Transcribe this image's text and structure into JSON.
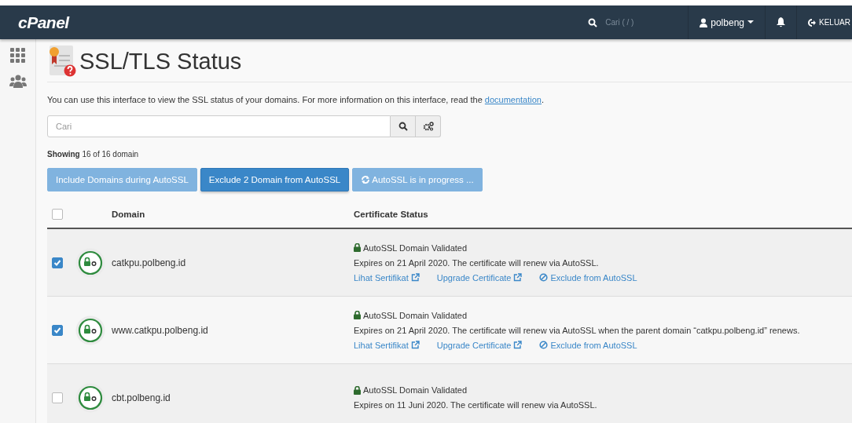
{
  "topbar": {
    "logo": "cPanel",
    "search": {
      "placeholder": "Cari ( / )"
    },
    "user": "polbeng",
    "logout": "KELUAR"
  },
  "page": {
    "title": "SSL/TLS Status",
    "intro_text": "You can use this interface to view the SSL status of your domains. For more information on this interface, read the ",
    "intro_link": "documentation",
    "intro_end": "."
  },
  "search": {
    "placeholder": "Cari"
  },
  "showing": "**Showing** 16 of 16 domain",
  "buttons": [
    {
      "label": "Include Domains during AutoSSL",
      "disabled": true,
      "kind": "plain"
    },
    {
      "label": "Exclude 2 Domain from AutoSSL",
      "disabled": false,
      "kind": "plain"
    },
    {
      "label": "AutoSSL is in progress ...",
      "disabled": true,
      "kind": "progress"
    }
  ],
  "table": {
    "select_all": {
      "checked": false
    },
    "columns": [
      "Domain",
      "Certificate Status"
    ],
    "rows": [
      {
        "checked": true,
        "domain": "catkpu.polbeng.id",
        "status": "AutoSSL Domain Validated",
        "expires": "Expires on 21 April 2020. The certificate will renew via AutoSSL.",
        "links": [
          "Lihat Sertifikat",
          "Upgrade Certificate",
          "Exclude from AutoSSL"
        ]
      },
      {
        "checked": true,
        "domain": "www.catkpu.polbeng.id",
        "status": "AutoSSL Domain Validated",
        "expires": "Expires on 21 April 2020. The certificate will renew via AutoSSL when the parent domain “catkpu.polbeng.id” renews.",
        "links": [
          "Lihat Sertifikat",
          "Upgrade Certificate",
          "Exclude from AutoSSL"
        ]
      },
      {
        "checked": false,
        "domain": "cbt.polbeng.id",
        "status": "AutoSSL Domain Validated",
        "expires": "Expires on 11 Juni 2020. The certificate will renew via AutoSSL.",
        "links": []
      }
    ]
  }
}
